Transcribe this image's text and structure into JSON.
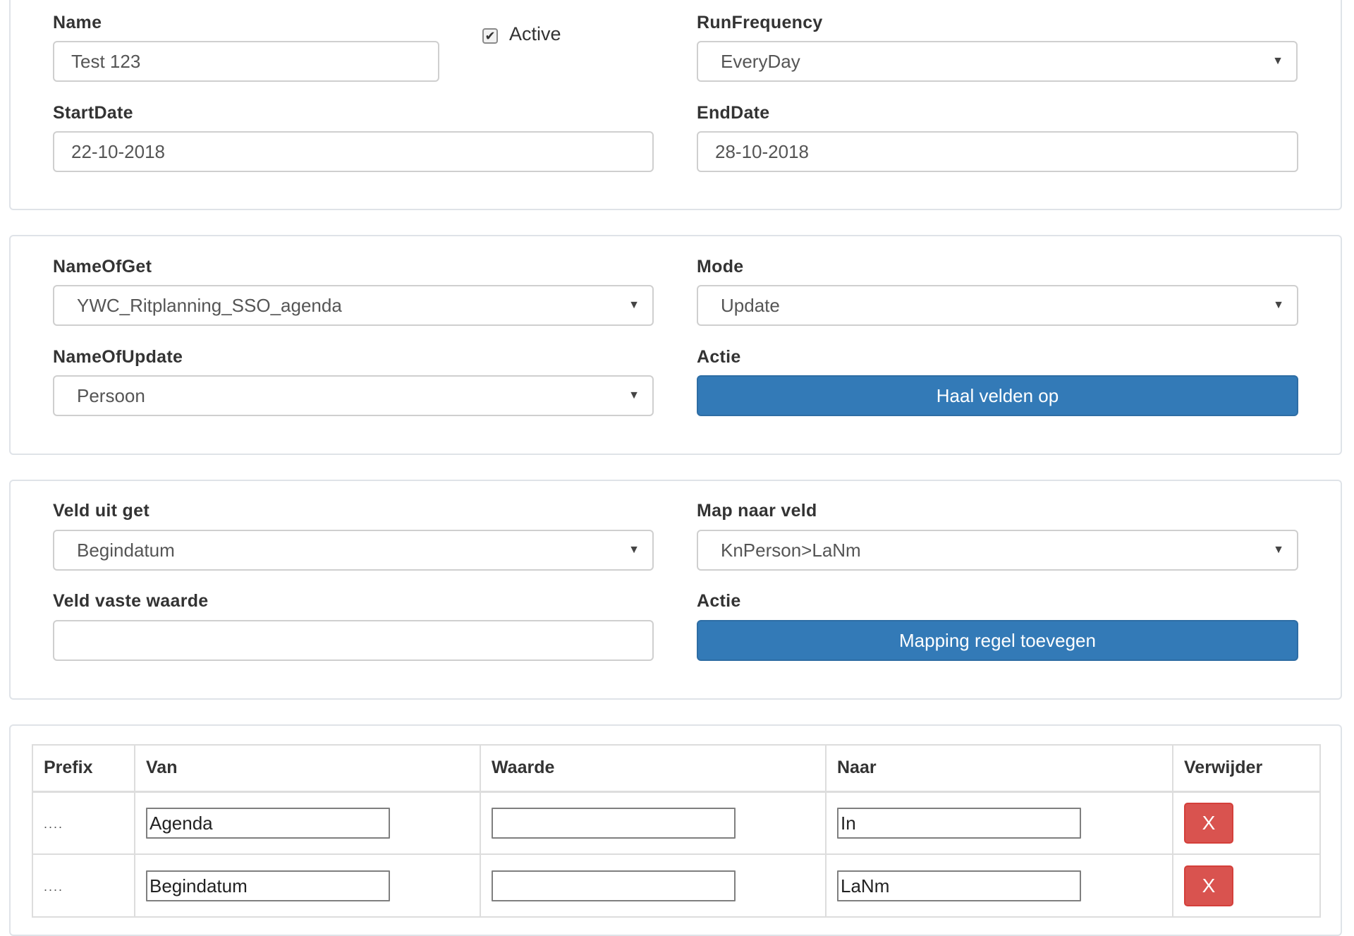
{
  "general": {
    "name_label": "Name",
    "name_value": "Test 123",
    "active_label": "Active",
    "active_checked": true,
    "runfrequency_label": "RunFrequency",
    "runfrequency_value": "EveryDay",
    "startdate_label": "StartDate",
    "startdate_value": "22-10-2018",
    "enddate_label": "EndDate",
    "enddate_value": "28-10-2018"
  },
  "connector": {
    "nameofget_label": "NameOfGet",
    "nameofget_value": "YWC_Ritplanning_SSO_agenda",
    "mode_label": "Mode",
    "mode_value": "Update",
    "nameofupdate_label": "NameOfUpdate",
    "nameofupdate_value": "Persoon",
    "actie_label": "Actie",
    "fetch_button": "Haal velden op"
  },
  "mapping": {
    "veld_uit_get_label": "Veld uit get",
    "veld_uit_get_value": "Begindatum",
    "map_naar_veld_label": "Map naar veld",
    "map_naar_veld_value": "KnPerson>LaNm",
    "veld_vaste_waarde_label": "Veld vaste waarde",
    "veld_vaste_waarde_value": "",
    "actie_label": "Actie",
    "add_button": "Mapping regel toevegen"
  },
  "table": {
    "headers": [
      "Prefix",
      "Van",
      "Waarde",
      "Naar",
      "Verwijder"
    ],
    "rows": [
      {
        "prefix": "....",
        "van": "Agenda",
        "waarde": "",
        "naar": "In",
        "delete": "X"
      },
      {
        "prefix": "....",
        "van": "Begindatum",
        "waarde": "",
        "naar": "LaNm",
        "delete": "X"
      }
    ]
  },
  "icons": {
    "dropdown": "caret-down-icon",
    "checkbox": "checkmark-icon",
    "delete": "x-icon"
  },
  "colors": {
    "primary_button": "#337ab7",
    "danger_button": "#d9534f"
  }
}
